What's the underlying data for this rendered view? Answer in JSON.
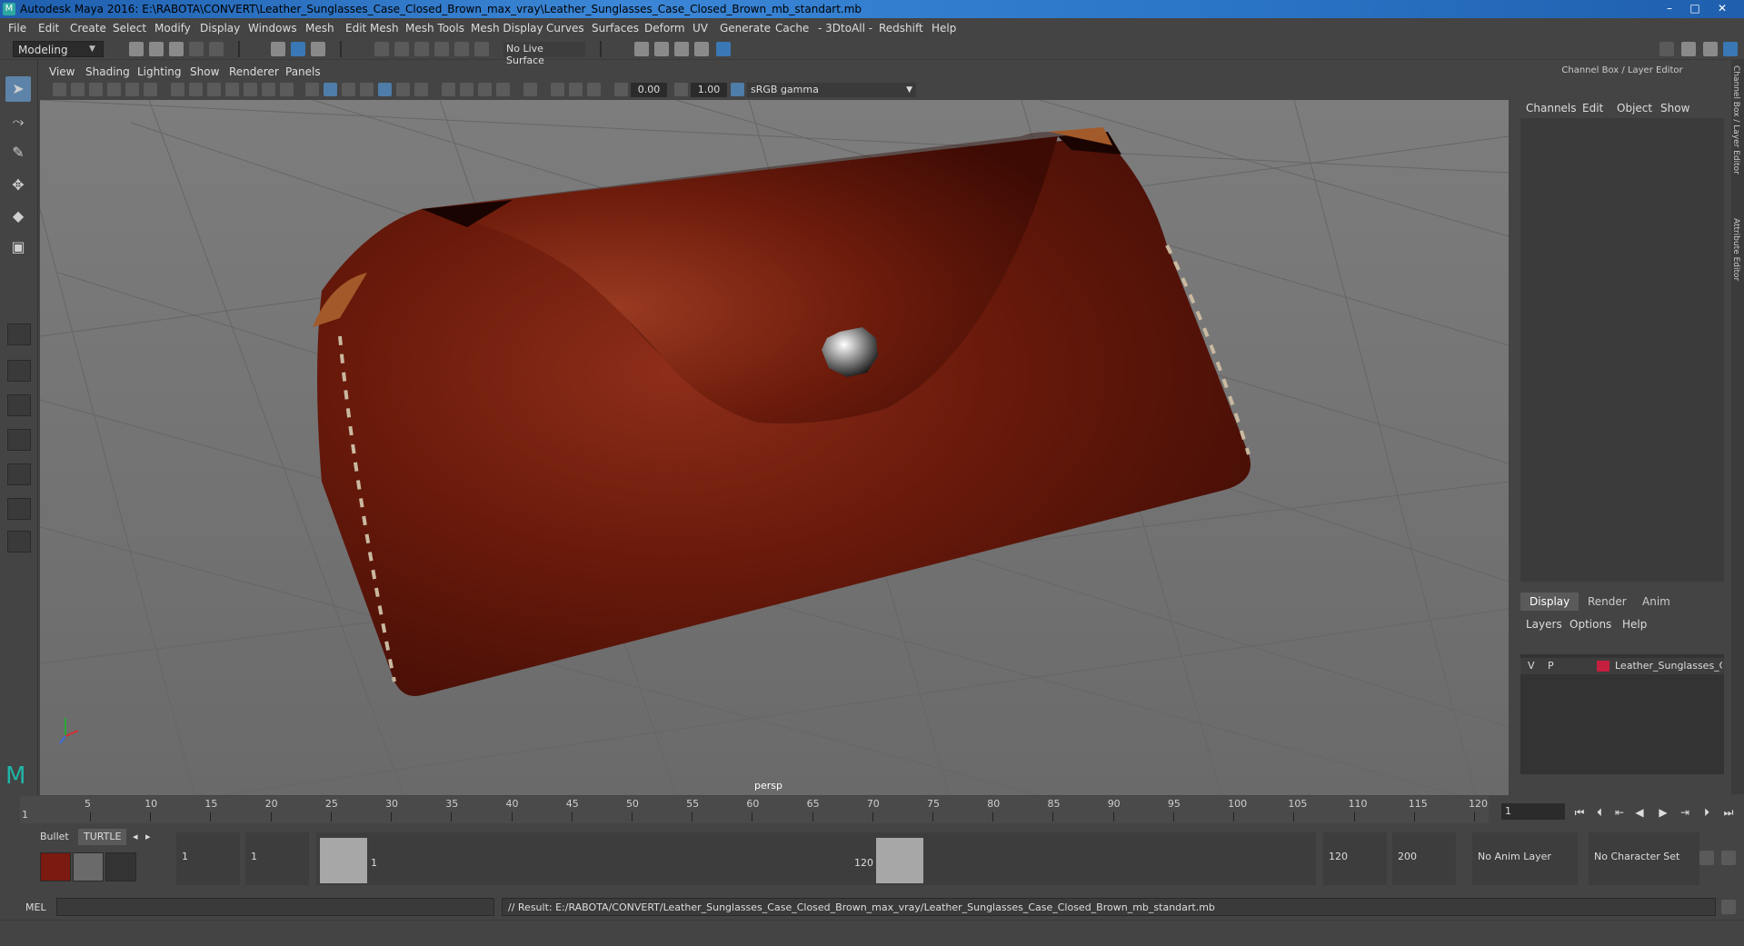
{
  "window": {
    "title": "Autodesk Maya 2016: E:\\RABOTA\\CONVERT\\Leather_Sunglasses_Case_Closed_Brown_max_vray\\Leather_Sunglasses_Case_Closed_Brown_mb_standart.mb",
    "minimize": "–",
    "restore": "□",
    "close": "✕"
  },
  "menu": [
    "File",
    "Edit",
    "Create",
    "Select",
    "Modify",
    "Display",
    "Windows",
    "Mesh",
    "Edit Mesh",
    "Mesh Tools",
    "Mesh Display",
    "Curves",
    "Surfaces",
    "Deform",
    "UV",
    "Generate",
    "Cache",
    "- 3DtoAll -",
    "Redshift",
    "Help"
  ],
  "statusline": {
    "mode": "Modeling",
    "live_surface": "No Live Surface"
  },
  "viewport": {
    "menu": [
      "View",
      "Shading",
      "Lighting",
      "Show",
      "Renderer",
      "Panels"
    ],
    "field_a": "0.00",
    "field_b": "1.00",
    "color_space": "sRGB gamma",
    "camera": "persp"
  },
  "channel_box": {
    "title": "Channel Box / Layer Editor",
    "menu": [
      "Channels",
      "Edit",
      "Object",
      "Show"
    ]
  },
  "layer_editor": {
    "tabs": [
      "Display",
      "Render",
      "Anim"
    ],
    "menu": [
      "Layers",
      "Options",
      "Help"
    ],
    "layer": {
      "v": "V",
      "p": "P",
      "name": "Leather_Sunglasses_Case"
    }
  },
  "side_tabs": [
    "Channel Box / Layer Editor",
    "Attribute Editor"
  ],
  "timeline": {
    "ticks": [
      5,
      10,
      15,
      20,
      25,
      30,
      35,
      40,
      45,
      50,
      55,
      60,
      65,
      70,
      75,
      80,
      85,
      90,
      95,
      100,
      105,
      110,
      115,
      120
    ],
    "start_marker": "1",
    "current_frame": "1"
  },
  "shelf": {
    "tabs": [
      "Bullet",
      "TURTLE"
    ]
  },
  "range": {
    "start": "1",
    "playback_start": "1",
    "range_start_label": "1",
    "range_end_label": "120",
    "end": "120",
    "anim_end": "200",
    "anim_layer": "No Anim Layer",
    "character_set": "No Character Set"
  },
  "cmdline": {
    "label": "MEL",
    "result": "// Result: E:/RABOTA/CONVERT/Leather_Sunglasses_Case_Closed_Brown_max_vray/Leather_Sunglasses_Case_Closed_Brown_mb_standart.mb"
  },
  "colors": {
    "leather": "#7a1d0e",
    "leather_dark": "#3d0b04",
    "accent": "#5d83a8",
    "layer": "#c41f3f"
  }
}
